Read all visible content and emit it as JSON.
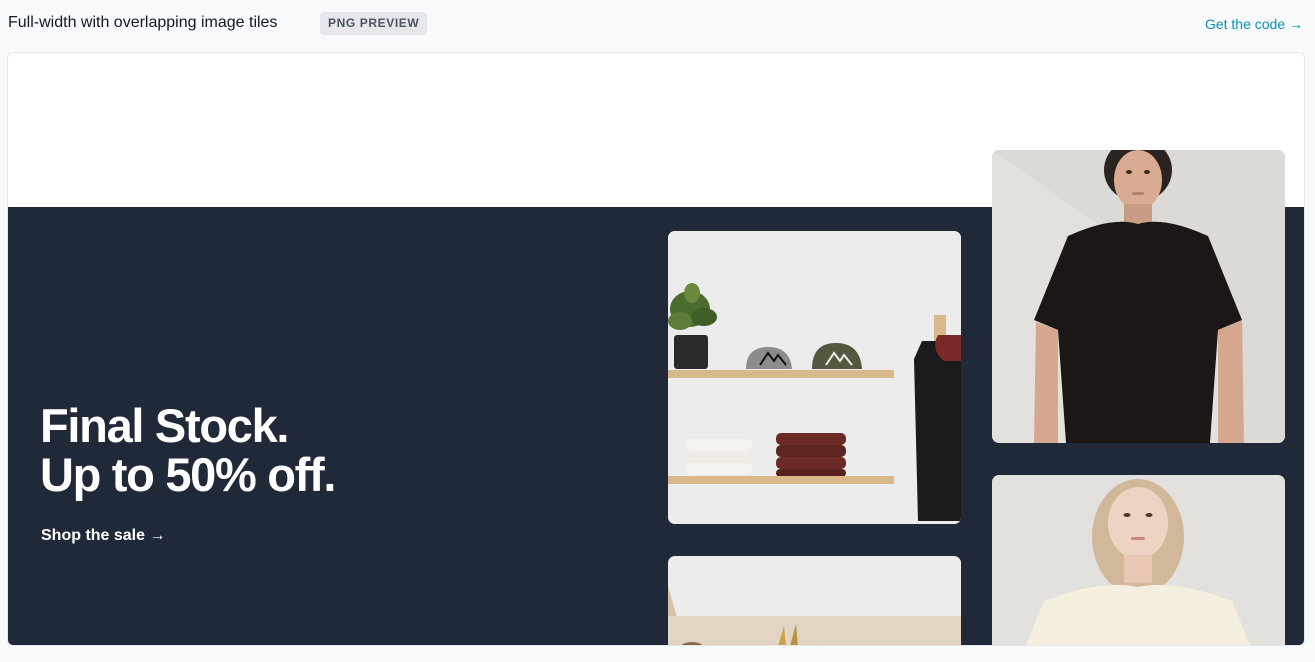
{
  "header": {
    "title": "Full-width with overlapping image tiles",
    "badge": "PNG PREVIEW",
    "code_link": "Get the code →"
  },
  "hero": {
    "headline_line1": "Final Stock.",
    "headline_line2": "Up to 50% off.",
    "cta": "Shop the sale →"
  },
  "colors": {
    "hero_bg": "#1f2937",
    "link": "#0891b2",
    "page_bg": "#f8fafc"
  }
}
